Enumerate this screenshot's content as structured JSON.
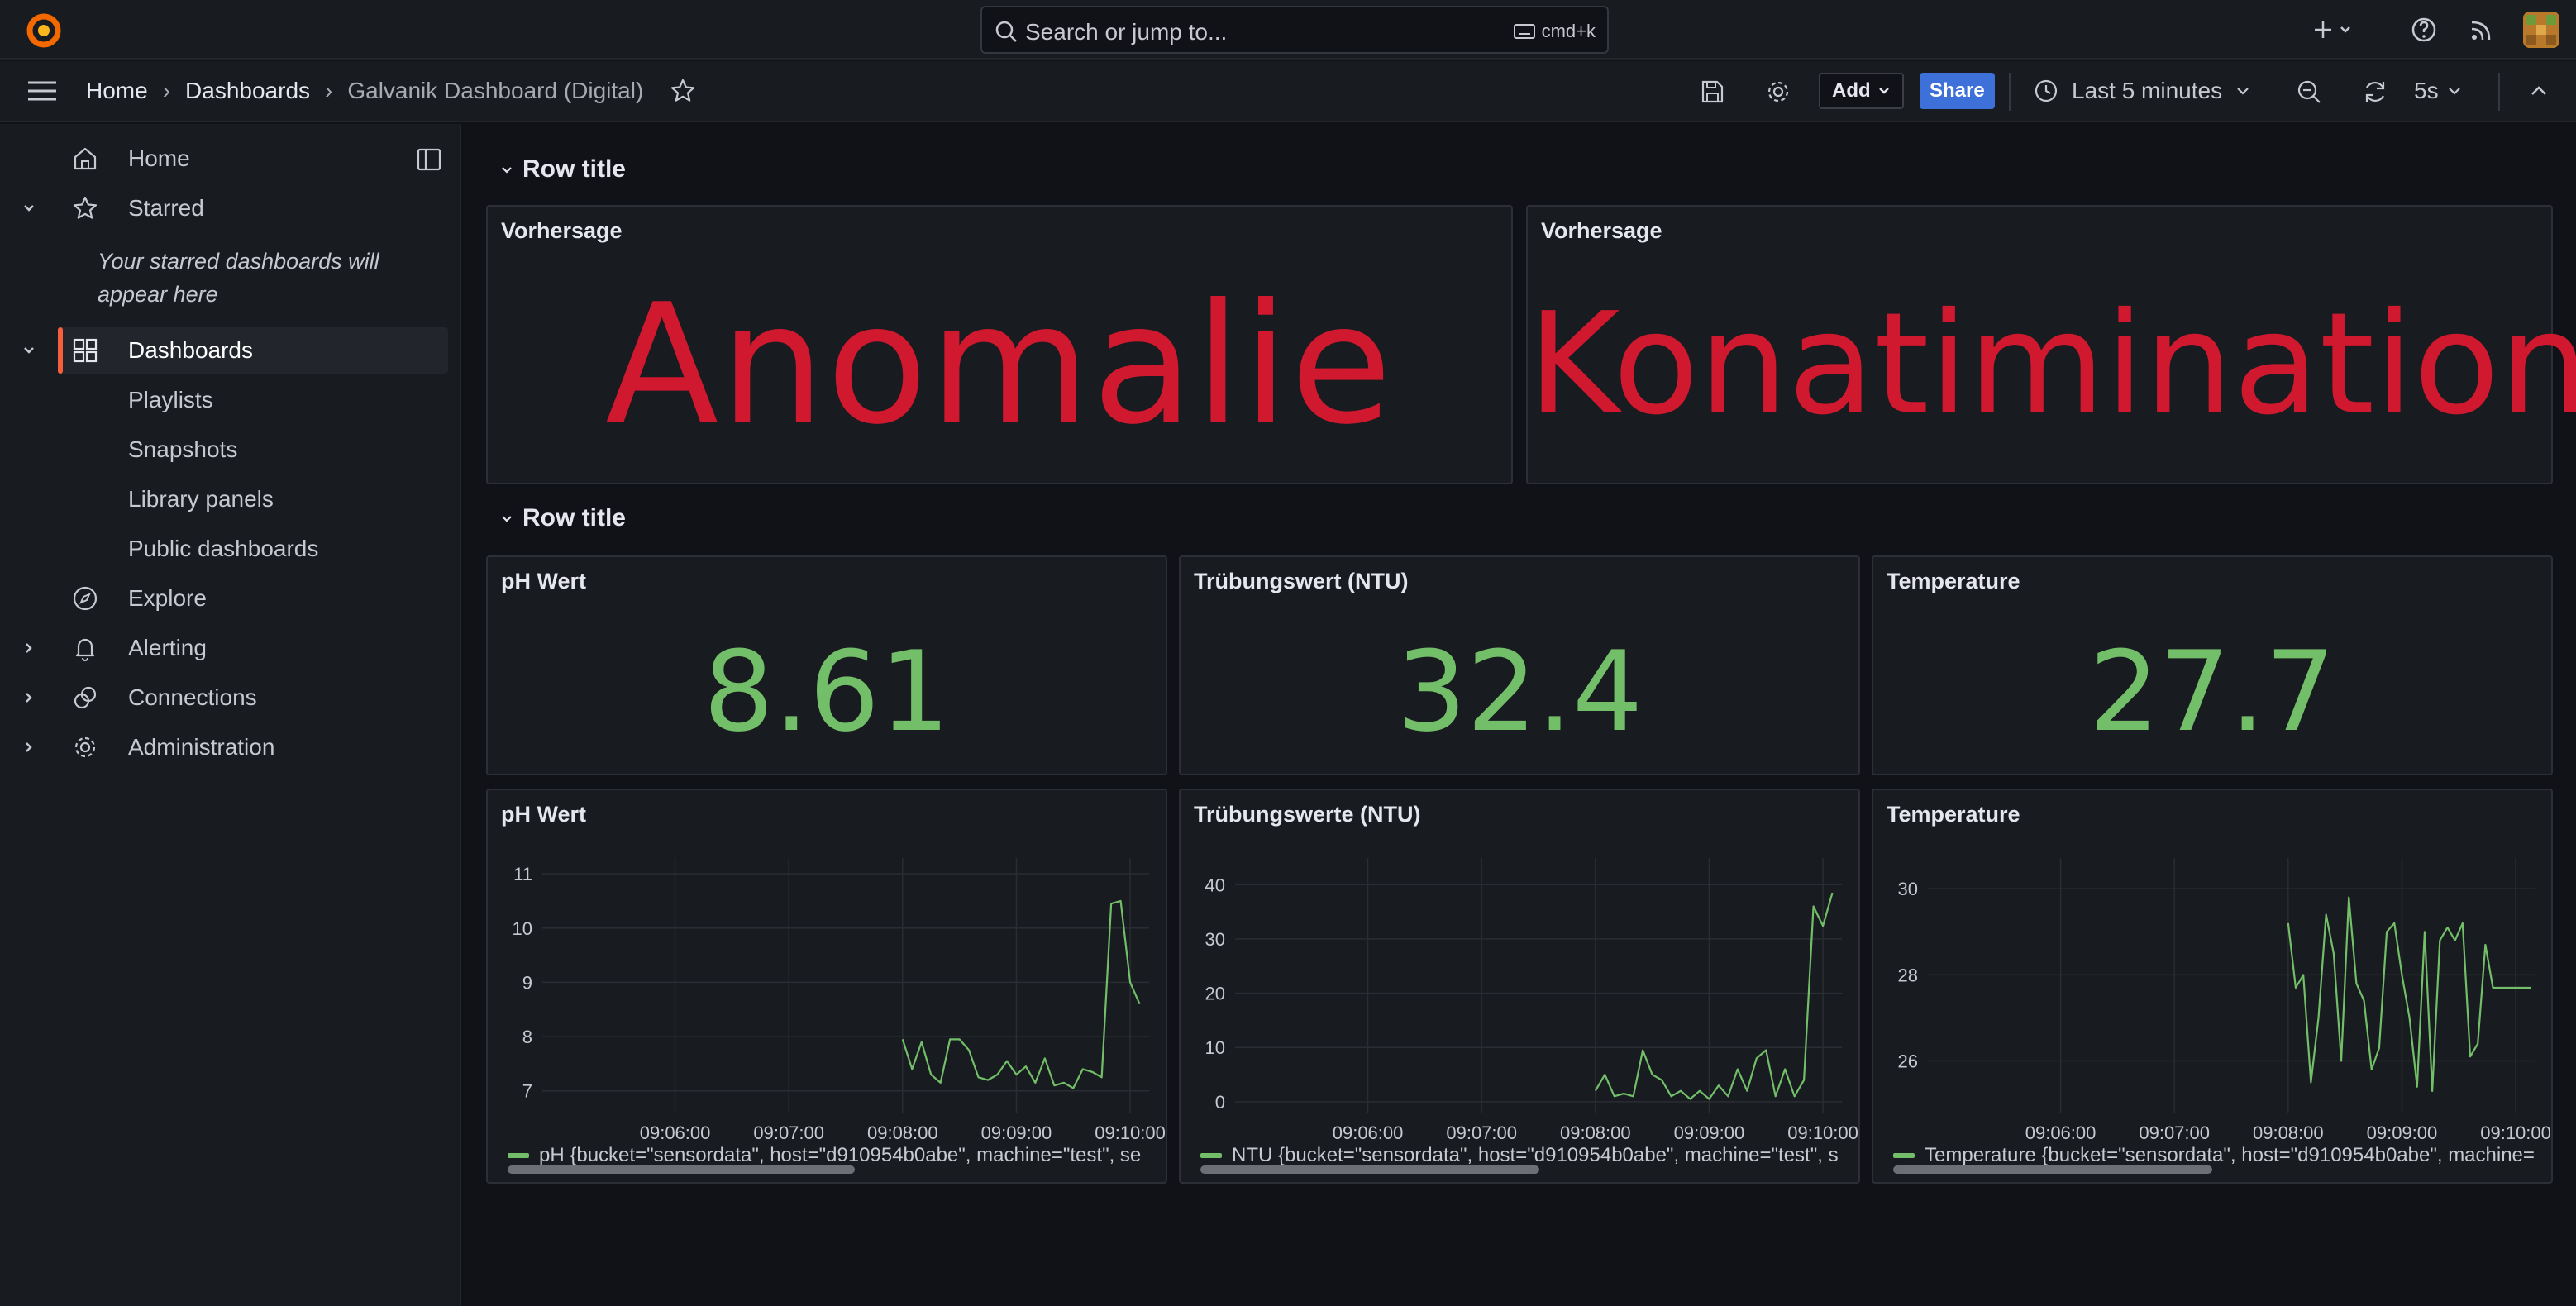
{
  "topbar": {
    "search_placeholder": "Search or jump to...",
    "search_shortcut": "cmd+k"
  },
  "breadcrumb": {
    "items": [
      "Home",
      "Dashboards",
      "Galvanik Dashboard (Digital)"
    ]
  },
  "toolbar": {
    "add_label": "Add",
    "share_label": "Share",
    "time_range": "Last 5 minutes",
    "refresh_interval": "5s"
  },
  "sidebar": {
    "items": [
      {
        "label": "Home"
      },
      {
        "label": "Starred"
      },
      {
        "label": "Dashboards"
      },
      {
        "label": "Playlists"
      },
      {
        "label": "Snapshots"
      },
      {
        "label": "Library panels"
      },
      {
        "label": "Public dashboards"
      },
      {
        "label": "Explore"
      },
      {
        "label": "Alerting"
      },
      {
        "label": "Connections"
      },
      {
        "label": "Administration"
      }
    ],
    "starred_empty": "Your starred dashboards will appear here"
  },
  "rows": [
    {
      "title": "Row title"
    },
    {
      "title": "Row title"
    }
  ],
  "prediction_panels": [
    {
      "title": "Vorhersage",
      "value": "Anomalie",
      "color": "#d0182f"
    },
    {
      "title": "Vorhersage",
      "value": "Konatimination",
      "color": "#d0182f"
    }
  ],
  "stat_panels": [
    {
      "title": "pH Wert",
      "value": "8.61",
      "color": "#73bf69"
    },
    {
      "title": "Trübungswert (NTU)",
      "value": "32.4",
      "color": "#73bf69"
    },
    {
      "title": "Temperature",
      "value": "27.7",
      "color": "#73bf69"
    }
  ],
  "timeseries_panels": [
    {
      "title": "pH Wert",
      "legend": "pH {bucket=\"sensordata\", host=\"d910954b0abe\", machine=\"test\", se"
    },
    {
      "title": "Trübungswerte (NTU)",
      "legend": "NTU {bucket=\"sensordata\", host=\"d910954b0abe\", machine=\"test\", s"
    },
    {
      "title": "Temperature",
      "legend": "Temperature {bucket=\"sensordata\", host=\"d910954b0abe\", machine="
    }
  ],
  "chart_data": [
    {
      "type": "line",
      "x_ticks": [
        "09:06:00",
        "09:07:00",
        "09:08:00",
        "09:09:00",
        "09:10:00"
      ],
      "y_ticks": [
        7,
        8,
        9,
        10,
        11
      ],
      "ylim": [
        6.6,
        11.2
      ],
      "x_range_seconds": [
        -80,
        225
      ],
      "series": [
        {
          "color": "#73bf69",
          "x": [
            120,
            125,
            130,
            135,
            140,
            145,
            150,
            155,
            160,
            165,
            170,
            175,
            180,
            185,
            190,
            195,
            200,
            205,
            210,
            215,
            220,
            225,
            230,
            235,
            240,
            245
          ],
          "y": [
            7.95,
            7.4,
            7.9,
            7.3,
            7.15,
            7.95,
            7.95,
            7.75,
            7.25,
            7.2,
            7.3,
            7.55,
            7.3,
            7.45,
            7.15,
            7.6,
            7.1,
            7.15,
            7.05,
            7.4,
            7.35,
            7.25,
            10.45,
            10.5,
            9.0,
            8.6
          ]
        }
      ]
    },
    {
      "type": "line",
      "x_ticks": [
        "09:06:00",
        "09:07:00",
        "09:08:00",
        "09:09:00",
        "09:10:00"
      ],
      "y_ticks": [
        0,
        10,
        20,
        30,
        40
      ],
      "ylim": [
        -2,
        44
      ],
      "series": [
        {
          "color": "#73bf69",
          "x": [
            120,
            125,
            130,
            135,
            140,
            145,
            150,
            155,
            160,
            165,
            170,
            175,
            180,
            185,
            190,
            195,
            200,
            205,
            210,
            215,
            220,
            225,
            230,
            235,
            240,
            245
          ],
          "y": [
            2,
            5,
            1,
            1.5,
            1,
            9.5,
            5,
            4,
            1,
            2,
            0.5,
            2,
            0.5,
            3,
            1,
            6,
            2,
            8,
            9.5,
            1,
            6,
            1,
            4,
            36,
            32.4,
            38.5
          ]
        }
      ]
    },
    {
      "type": "line",
      "x_ticks": [
        "09:06:00",
        "09:07:00",
        "09:08:00",
        "09:09:00",
        "09:10:00"
      ],
      "y_ticks": [
        26,
        28,
        30
      ],
      "ylim": [
        24.8,
        30.6
      ],
      "series": [
        {
          "color": "#73bf69",
          "x": [
            120,
            124,
            128,
            132,
            136,
            140,
            144,
            148,
            152,
            156,
            160,
            164,
            168,
            172,
            176,
            180,
            184,
            188,
            192,
            196,
            200,
            204,
            208,
            212,
            216,
            220,
            224,
            228,
            232,
            236,
            240,
            244,
            248
          ],
          "y": [
            29.2,
            27.7,
            28.0,
            25.5,
            27.0,
            29.4,
            28.5,
            26.0,
            29.8,
            27.8,
            27.4,
            25.8,
            26.3,
            29.0,
            29.2,
            28.0,
            27.0,
            25.4,
            29.0,
            25.3,
            28.8,
            29.1,
            28.8,
            29.2,
            26.1,
            26.4,
            28.7,
            27.7,
            27.7,
            27.7,
            27.7,
            27.7,
            27.7
          ]
        }
      ]
    }
  ]
}
